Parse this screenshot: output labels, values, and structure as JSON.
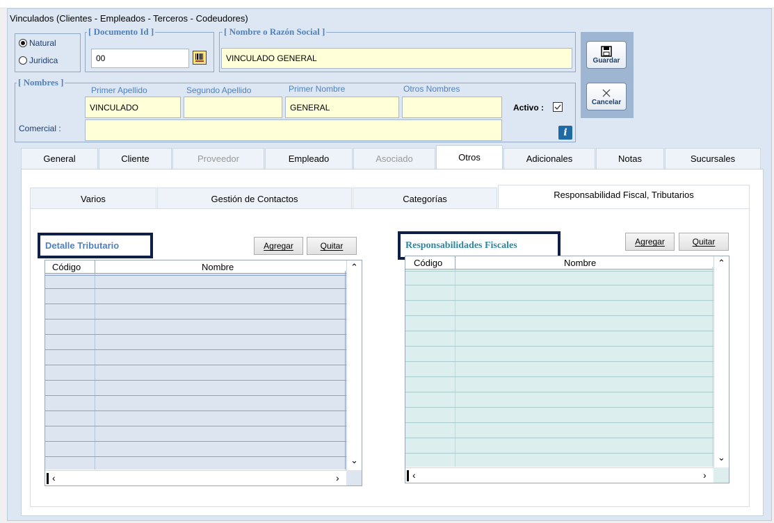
{
  "window": {
    "title": "Vinculados   (Clientes - Empleados - Terceros - Codeudores)"
  },
  "persona": {
    "options": [
      "Natural",
      "Juridica"
    ],
    "selected": "Natural"
  },
  "documento": {
    "legend": "[ Documento Id ]",
    "value": "00"
  },
  "nombre_razon": {
    "legend": "[ Nombre o Razón Social ]",
    "value": "VINCULADO GENERAL"
  },
  "nombres": {
    "legend": "[ Nombres ]",
    "primer_apellido_label": "Primer Apellido",
    "segundo_apellido_label": "Segundo Apellido",
    "primer_nombre_label": "Primer Nombre",
    "otros_nombres_label": "Otros Nombres",
    "primer_apellido": "VINCULADO",
    "segundo_apellido": "",
    "primer_nombre": "GENERAL",
    "otros_nombres": "",
    "activo_label": "Activo :",
    "activo_checked": true,
    "comercial_label": "Comercial :",
    "comercial": ""
  },
  "actions": {
    "save_label": "Guardar",
    "cancel_label": "Cancelar"
  },
  "tabs": [
    {
      "label": "General",
      "state": "normal"
    },
    {
      "label": "Cliente",
      "state": "normal"
    },
    {
      "label": "Proveedor",
      "state": "disabled"
    },
    {
      "label": "Empleado",
      "state": "normal"
    },
    {
      "label": "Asociado",
      "state": "disabled"
    },
    {
      "label": "Otros",
      "state": "active"
    },
    {
      "label": "Adicionales",
      "state": "normal"
    },
    {
      "label": "Notas",
      "state": "normal"
    },
    {
      "label": "Sucursales",
      "state": "normal"
    }
  ],
  "subtabs": [
    {
      "label": "Varios",
      "state": "normal"
    },
    {
      "label": "Gestión de Contactos",
      "state": "normal"
    },
    {
      "label": "Categorías",
      "state": "normal"
    },
    {
      "label": "Responsabilidad Fiscal, Tributarios",
      "state": "active"
    }
  ],
  "detalle": {
    "title": "Detalle Tributario",
    "title_color": "#4f81bd",
    "add_label": "Agregar",
    "remove_label": "Quitar",
    "columns": [
      "Código",
      "Nombre"
    ],
    "row_color": "#dde5f0"
  },
  "responsabilidades": {
    "title": "Responsabilidades Fiscales",
    "title_color": "#31859c",
    "add_label": "Agregar",
    "remove_label": "Quitar",
    "columns": [
      "Código",
      "Nombre"
    ],
    "row_color": "#dceeee"
  },
  "colors": {
    "accent": "#4f81bd",
    "highlight_border": "#0e2048",
    "field_bg": "#ffffd8"
  }
}
